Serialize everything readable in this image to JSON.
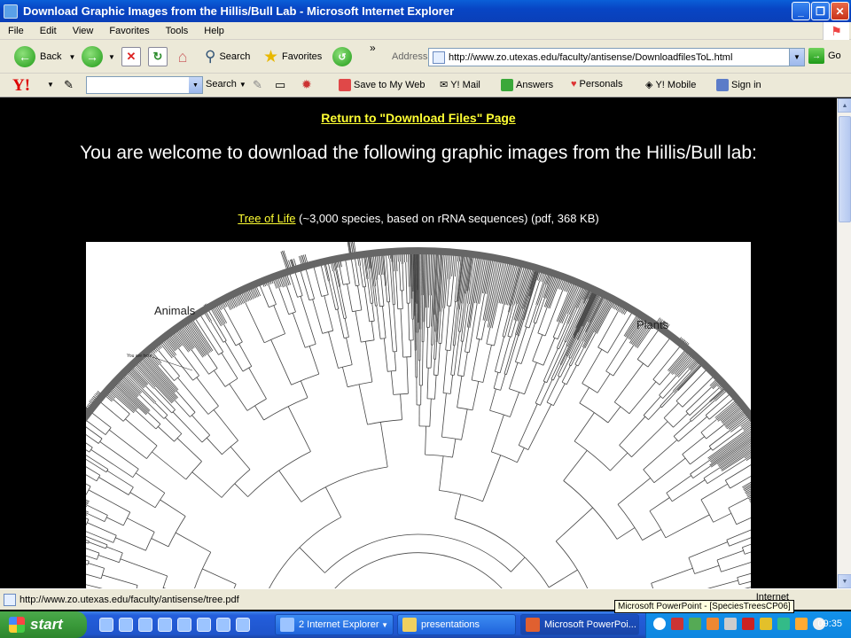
{
  "window": {
    "title": "Download Graphic Images from the Hillis/Bull Lab - Microsoft Internet Explorer"
  },
  "menu": [
    "File",
    "Edit",
    "View",
    "Favorites",
    "Tools",
    "Help"
  ],
  "toolbar": {
    "back": "Back",
    "search": "Search",
    "favorites": "Favorites",
    "chevron": "»",
    "address_label": "Address",
    "address_url": "http://www.zo.utexas.edu/faculty/antisense/DownloadfilesToL.html",
    "go": "Go"
  },
  "yahoo": {
    "logo": "Y!",
    "search": "Search",
    "save": "Save to My Web",
    "mail": "Y! Mail",
    "answers": "Answers",
    "personals": "Personals",
    "mobile": "Y! Mobile",
    "signin": "Sign in"
  },
  "content": {
    "return_link": "Return to \"Download Files\" Page",
    "headline": "You are welcome to download the following graphic images from the Hillis/Bull lab:",
    "tol_link": "Tree of Life",
    "tol_desc": " (~3,000 species, based on rRNA sequences) (pdf, 368 KB)",
    "tree_labels": {
      "animals": "Animals",
      "plants": "Plants",
      "you_are_here": "You are here"
    }
  },
  "status": {
    "text": "http://www.zo.utexas.edu/faculty/antisense/tree.pdf",
    "zone": "Internet"
  },
  "taskbar": {
    "start": "start",
    "tasks": [
      "2 Internet Explorer",
      "presentations",
      "Microsoft PowerPoi..."
    ],
    "tooltip": "Microsoft PowerPoint - [SpeciesTreesCP06]",
    "clock": "09:35"
  },
  "colors": {
    "link": "#ffff33",
    "title_bar": "#0845c4",
    "taskbar": "#245edb",
    "start": "#3a9a3a"
  }
}
